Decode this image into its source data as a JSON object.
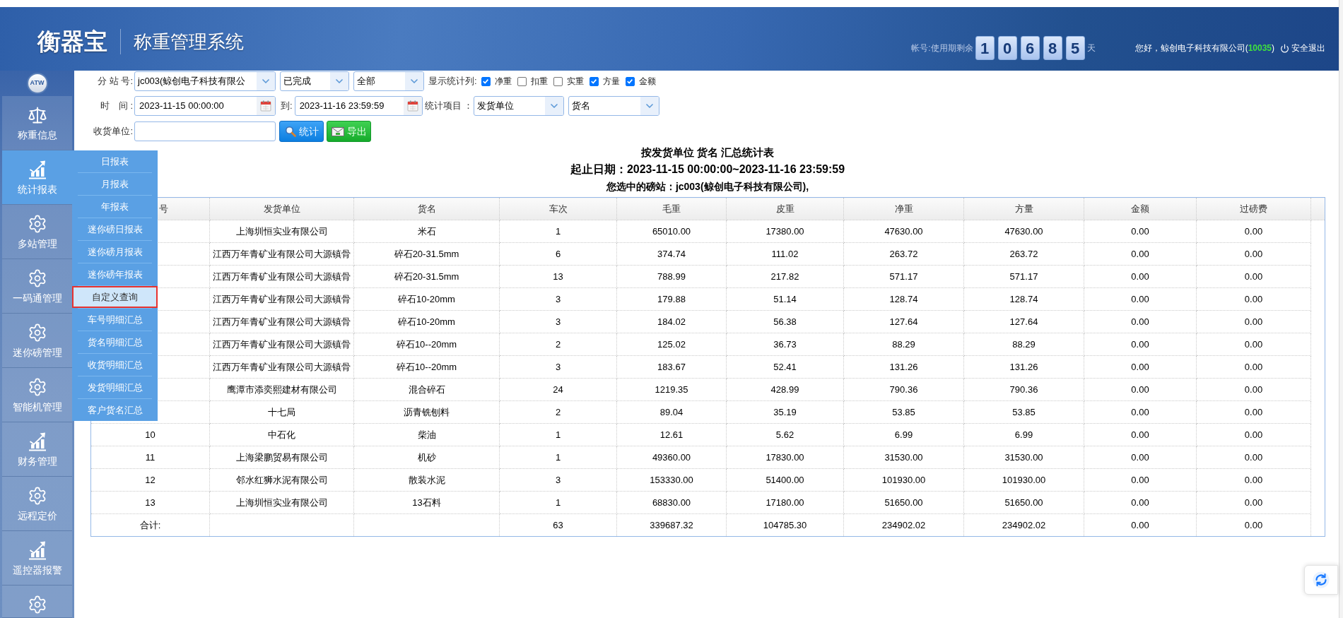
{
  "header": {
    "logo": "衡器宝",
    "system_name": "称重管理系统",
    "remaining_label": "帐号:使用期剩余",
    "remaining_digits": [
      "1",
      "0",
      "6",
      "8",
      "5"
    ],
    "remaining_unit": "天",
    "greeting_prefix": "您好，鲸创电子科技有限公司(",
    "account_id": "10035",
    "greeting_suffix": ")",
    "logout": "安全退出"
  },
  "sidebar": {
    "badge": "ATW",
    "items": [
      {
        "label": "称重信息",
        "kind": "weighing",
        "selected": false
      },
      {
        "label": "统计报表",
        "kind": "report",
        "selected": true,
        "submenu": [
          {
            "label": "日报表",
            "selected": false
          },
          {
            "label": "月报表",
            "selected": false
          },
          {
            "label": "年报表",
            "selected": false
          },
          {
            "label": "迷你磅日报表",
            "selected": false
          },
          {
            "label": "迷你磅月报表",
            "selected": false
          },
          {
            "label": "迷你磅年报表",
            "selected": false
          },
          {
            "label": "自定义查询",
            "selected": true
          },
          {
            "label": "车号明细汇总",
            "selected": false
          },
          {
            "label": "货名明细汇总",
            "selected": false
          },
          {
            "label": "收货明细汇总",
            "selected": false
          },
          {
            "label": "发货明细汇总",
            "selected": false
          },
          {
            "label": "客户货名汇总",
            "selected": false
          }
        ]
      },
      {
        "label": "多站管理",
        "kind": "settings",
        "selected": false
      },
      {
        "label": "一码通管理",
        "kind": "settings",
        "selected": false
      },
      {
        "label": "迷你磅管理",
        "kind": "settings",
        "selected": false
      },
      {
        "label": "智能机管理",
        "kind": "settings",
        "selected": false
      },
      {
        "label": "财务管理",
        "kind": "report",
        "selected": false
      },
      {
        "label": "远程定价",
        "kind": "settings",
        "selected": false
      },
      {
        "label": "遥控器报警",
        "kind": "report",
        "selected": false
      },
      {
        "kind": "settings",
        "selected": false
      }
    ]
  },
  "filters": {
    "station_label": "分 站 号:",
    "station": "jc003(鲸创电子科技有限公",
    "status": "已完成",
    "scope": "全部",
    "columns_label": "显示统计列:",
    "columns": [
      {
        "label": "净重",
        "checked": true
      },
      {
        "label": "扣重",
        "checked": false
      },
      {
        "label": "实重",
        "checked": false
      },
      {
        "label": "方量",
        "checked": true
      },
      {
        "label": "金额",
        "checked": true
      }
    ],
    "time_label": "时　间 :",
    "start": "2023-11-15 00:00:00",
    "to_label": "到:",
    "end": "2023-11-16 23:59:59",
    "group_label": "统计项目 ：",
    "group_by": [
      "发货单位",
      "货名"
    ],
    "receiver_label": "收货单位:",
    "buttons": [
      {
        "label": "统计",
        "kind": "search"
      },
      {
        "label": "导出",
        "kind": "export"
      }
    ]
  },
  "report": {
    "title": "按发货单位 货名 汇总统计表",
    "date_range": "起止日期：2023-11-15 00:00:00~2023-11-16 23:59:59",
    "station": "您选中的磅站：jc003(鲸创电子科技有限公司),",
    "columns": [
      "号",
      "发货单位",
      "货名",
      "车次",
      "毛重",
      "皮重",
      "净重",
      "方量",
      "金额",
      "过磅费"
    ],
    "rows": [
      {
        "shipper": "上海圳恒实业有限公司",
        "goods": "米石",
        "trips": "1",
        "gross": "65010.00",
        "tare": "17380.00",
        "net": "47630.00",
        "volume": "47630.00",
        "amount": "0.00",
        "fee": "0.00"
      },
      {
        "shipper": "江西万年青矿业有限公司大源镇骨",
        "goods": "碎石20-31.5mm",
        "trips": "6",
        "gross": "374.74",
        "tare": "111.02",
        "net": "263.72",
        "volume": "263.72",
        "amount": "0.00",
        "fee": "0.00"
      },
      {
        "shipper": "江西万年青矿业有限公司大源镇骨",
        "goods": "碎石20-31.5mm",
        "trips": "13",
        "gross": "788.99",
        "tare": "217.82",
        "net": "571.17",
        "volume": "571.17",
        "amount": "0.00",
        "fee": "0.00"
      },
      {
        "shipper": "江西万年青矿业有限公司大源镇骨",
        "goods": "碎石10-20mm",
        "trips": "3",
        "gross": "179.88",
        "tare": "51.14",
        "net": "128.74",
        "volume": "128.74",
        "amount": "0.00",
        "fee": "0.00"
      },
      {
        "shipper": "江西万年青矿业有限公司大源镇骨",
        "goods": "碎石10-20mm",
        "trips": "3",
        "gross": "184.02",
        "tare": "56.38",
        "net": "127.64",
        "volume": "127.64",
        "amount": "0.00",
        "fee": "0.00"
      },
      {
        "shipper": "江西万年青矿业有限公司大源镇骨",
        "goods": "碎石10--20mm",
        "trips": "2",
        "gross": "125.02",
        "tare": "36.73",
        "net": "88.29",
        "volume": "88.29",
        "amount": "0.00",
        "fee": "0.00"
      },
      {
        "shipper": "江西万年青矿业有限公司大源镇骨",
        "goods": "碎石10--20mm",
        "trips": "3",
        "gross": "183.67",
        "tare": "52.41",
        "net": "131.26",
        "volume": "131.26",
        "amount": "0.00",
        "fee": "0.00"
      },
      {
        "shipper": "鹰潭市添奕熙建材有限公司",
        "goods": "混合碎石",
        "trips": "24",
        "gross": "1219.35",
        "tare": "428.99",
        "net": "790.36",
        "volume": "790.36",
        "amount": "0.00",
        "fee": "0.00"
      },
      {
        "shipper": "十七局",
        "goods": "沥青铣刨料",
        "trips": "2",
        "gross": "89.04",
        "tare": "35.19",
        "net": "53.85",
        "volume": "53.85",
        "amount": "0.00",
        "fee": "0.00"
      },
      {
        "no": "10",
        "shipper": "中石化",
        "goods": "柴油",
        "trips": "1",
        "gross": "12.61",
        "tare": "5.62",
        "net": "6.99",
        "volume": "6.99",
        "amount": "0.00",
        "fee": "0.00"
      },
      {
        "no": "11",
        "shipper": "上海梁鹏贸易有限公司",
        "goods": "机砂",
        "trips": "1",
        "gross": "49360.00",
        "tare": "17830.00",
        "net": "31530.00",
        "volume": "31530.00",
        "amount": "0.00",
        "fee": "0.00"
      },
      {
        "no": "12",
        "shipper": "邻水红狮水泥有限公司",
        "goods": "散装水泥",
        "trips": "3",
        "gross": "153330.00",
        "tare": "51400.00",
        "net": "101930.00",
        "volume": "101930.00",
        "amount": "0.00",
        "fee": "0.00"
      },
      {
        "no": "13",
        "shipper": "上海圳恒实业有限公司",
        "goods": "13石料",
        "trips": "1",
        "gross": "68830.00",
        "tare": "17180.00",
        "net": "51650.00",
        "volume": "51650.00",
        "amount": "0.00",
        "fee": "0.00"
      }
    ],
    "total": {
      "no": "合计:",
      "trips": "63",
      "gross": "339687.32",
      "tare": "104785.30",
      "net": "234902.02",
      "volume": "234902.02",
      "amount": "0.00",
      "fee": "0.00"
    }
  }
}
